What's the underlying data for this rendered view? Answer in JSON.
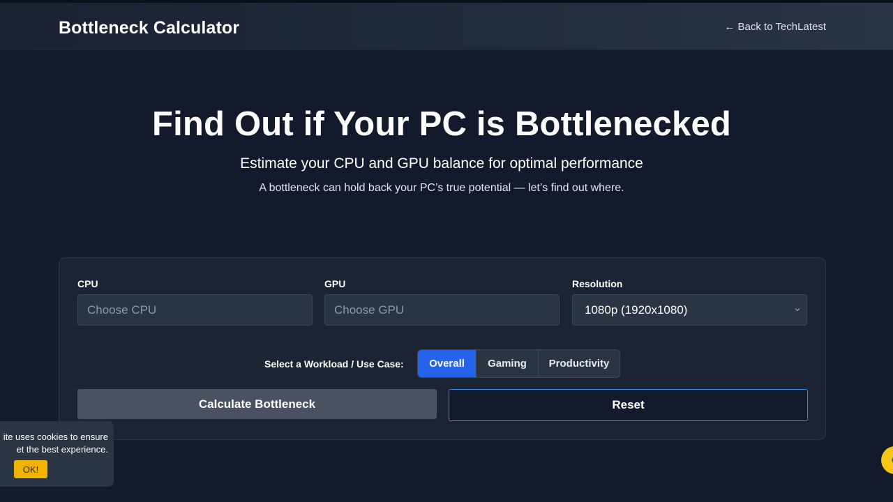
{
  "header": {
    "brand": "Bottleneck Calculator",
    "back_link": "← Back to TechLatest"
  },
  "hero": {
    "title": "Find Out if Your PC is Bottlenecked",
    "subtitle": "Estimate your CPU and GPU balance for optimal performance",
    "description": "A bottleneck can hold back your PC’s true potential — let’s find out where."
  },
  "form": {
    "cpu": {
      "label": "CPU",
      "placeholder": "Choose CPU",
      "value": ""
    },
    "gpu": {
      "label": "GPU",
      "placeholder": "Choose GPU",
      "value": ""
    },
    "resolution": {
      "label": "Resolution",
      "value": "1080p (1920x1080)",
      "icon": "chevron-down-icon"
    },
    "workload": {
      "label": "Select a Workload / Use Case:",
      "options": [
        {
          "label": "Overall",
          "active": true
        },
        {
          "label": "Gaming",
          "active": false
        },
        {
          "label": "Productivity",
          "active": false
        }
      ]
    },
    "calculate_label": "Calculate Bottleneck",
    "reset_label": "Reset"
  },
  "cookie_banner": {
    "line1": "ite uses cookies to ensure",
    "line2": "et the best experience.",
    "ok_label": "OK!"
  },
  "colors": {
    "page_bg": "#131a2b",
    "card_bg": "#1c2434",
    "accent_blue": "#2563eb",
    "cookie_ok": "#f0b400",
    "fab": "#f5c518"
  }
}
